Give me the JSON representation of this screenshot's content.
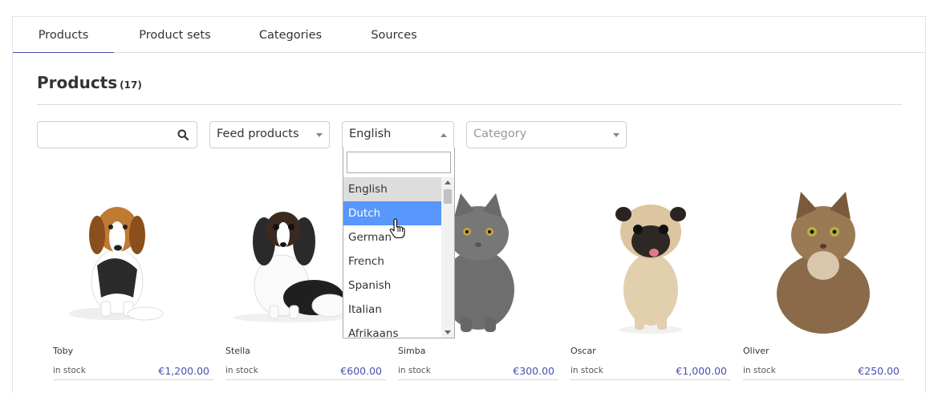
{
  "tabs": [
    {
      "label": "Products",
      "active": true
    },
    {
      "label": "Product sets",
      "active": false
    },
    {
      "label": "Categories",
      "active": false
    },
    {
      "label": "Sources",
      "active": false
    }
  ],
  "page": {
    "title": "Products",
    "count": "(17)"
  },
  "filters": {
    "search_value": "",
    "source_select": "Feed products",
    "language_select": "English",
    "category_placeholder": "Category"
  },
  "language_dropdown": {
    "search_value": "",
    "options": [
      "English",
      "Dutch",
      "German",
      "French",
      "Spanish",
      "Italian",
      "Afrikaans"
    ],
    "selected": "English",
    "hovered": "Dutch"
  },
  "products": [
    {
      "name": "Toby",
      "stock": "in stock",
      "price": "€1,200.00",
      "animal": "beagle"
    },
    {
      "name": "Stella",
      "stock": "in stock",
      "price": "€600.00",
      "animal": "cavalier"
    },
    {
      "name": "Simba",
      "stock": "in stock",
      "price": "€300.00",
      "animal": "grey-cat"
    },
    {
      "name": "Oscar",
      "stock": "in stock",
      "price": "€1,000.00",
      "animal": "pug"
    },
    {
      "name": "Oliver",
      "stock": "in stock",
      "price": "€250.00",
      "animal": "longhair-cat"
    }
  ],
  "colors": {
    "accent": "#4a4fae",
    "hover": "#5897fb"
  }
}
